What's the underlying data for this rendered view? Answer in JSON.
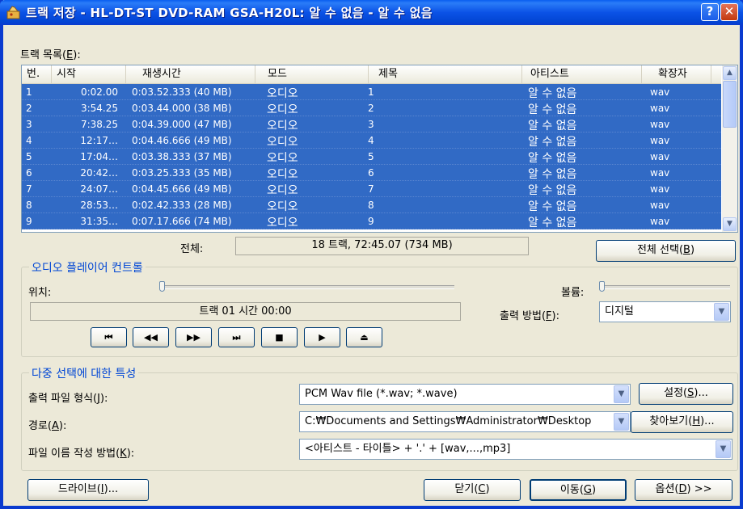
{
  "window": {
    "title": "트랙 저장 - HL-DT-ST DVD-RAM GSA-H20L:  알 수 없음  - 알 수 없음",
    "help_label": "?",
    "close_label": "✕"
  },
  "tracklist": {
    "label_prefix": "트랙 목록(",
    "label_key": "E",
    "label_suffix": "):",
    "headers": [
      "번.",
      "시작",
      "재생시간",
      "모드",
      "제목",
      "아티스트",
      "확장자"
    ],
    "rows": [
      {
        "num": "1",
        "start": "0:02.00",
        "duration": "0:03.52.333 (40 MB)",
        "mode": "오디오",
        "title": "1",
        "artist": "알 수 없음",
        "ext": "wav"
      },
      {
        "num": "2",
        "start": "3:54.25",
        "duration": "0:03.44.000 (38 MB)",
        "mode": "오디오",
        "title": "2",
        "artist": "알 수 없음",
        "ext": "wav"
      },
      {
        "num": "3",
        "start": "7:38.25",
        "duration": "0:04.39.000 (47 MB)",
        "mode": "오디오",
        "title": "3",
        "artist": "알 수 없음",
        "ext": "wav"
      },
      {
        "num": "4",
        "start": "12:17…",
        "duration": "0:04.46.666 (49 MB)",
        "mode": "오디오",
        "title": "4",
        "artist": "알 수 없음",
        "ext": "wav"
      },
      {
        "num": "5",
        "start": "17:04…",
        "duration": "0:03.38.333 (37 MB)",
        "mode": "오디오",
        "title": "5",
        "artist": "알 수 없음",
        "ext": "wav"
      },
      {
        "num": "6",
        "start": "20:42…",
        "duration": "0:03.25.333 (35 MB)",
        "mode": "오디오",
        "title": "6",
        "artist": "알 수 없음",
        "ext": "wav"
      },
      {
        "num": "7",
        "start": "24:07…",
        "duration": "0:04.45.666 (49 MB)",
        "mode": "오디오",
        "title": "7",
        "artist": "알 수 없음",
        "ext": "wav"
      },
      {
        "num": "8",
        "start": "28:53…",
        "duration": "0:02.42.333 (28 MB)",
        "mode": "오디오",
        "title": "8",
        "artist": "알 수 없음",
        "ext": "wav"
      },
      {
        "num": "9",
        "start": "31:35…",
        "duration": "0:07.17.666 (74 MB)",
        "mode": "오디오",
        "title": "9",
        "artist": "알 수 없음",
        "ext": "wav"
      }
    ],
    "scroll_up_icon": "▲",
    "scroll_down_icon": "▼"
  },
  "summary": {
    "label": "전체:",
    "value": "18 트랙,  72:45.07 (734 MB)",
    "select_all_prefix": "전체 선택(",
    "select_all_key": "B",
    "select_all_suffix": ")"
  },
  "player": {
    "group_title": "오디오 플레이어 컨트롤",
    "position_label": "위치:",
    "volume_label": "볼륨:",
    "status": "트랙 01 시간 00:00",
    "output_method_prefix": "출력 방법(",
    "output_method_key": "F",
    "output_method_suffix": "):",
    "output_method_value": "디지털",
    "position_value": 0,
    "volume_value": 0,
    "buttons": [
      {
        "name": "skip-to-start-icon",
        "glyph": "⏮"
      },
      {
        "name": "rewind-icon",
        "glyph": "◀◀"
      },
      {
        "name": "fast-forward-icon",
        "glyph": "▶▶"
      },
      {
        "name": "skip-to-end-icon",
        "glyph": "⏭"
      },
      {
        "name": "stop-icon",
        "glyph": "■"
      },
      {
        "name": "play-icon",
        "glyph": "▶"
      },
      {
        "name": "eject-icon",
        "glyph": "⏏"
      }
    ]
  },
  "multi": {
    "group_title": "다중 선택에 대한 특성",
    "format_prefix": "출력 파일 형식(",
    "format_key": "J",
    "format_suffix": "):",
    "format_value": "PCM Wav file (*.wav; *.wave)",
    "settings_prefix": "설정(",
    "settings_key": "S",
    "settings_suffix": ")...",
    "path_prefix": "경로(",
    "path_key": "A",
    "path_suffix": "):",
    "path_value": "C:₩Documents and Settings₩Administrator₩Desktop",
    "browse_prefix": "찾아보기(",
    "browse_key": "H",
    "browse_suffix": ")...",
    "naming_prefix": "파일 이름 작성 방법(",
    "naming_key": "K",
    "naming_suffix": "):",
    "naming_value": "<아티스트 - 타이틀> + '.' + [wav,...,mp3]"
  },
  "footer": {
    "drive_prefix": "드라이브(",
    "drive_key": "I",
    "drive_suffix": ")...",
    "close_prefix": "닫기(",
    "close_key": "C",
    "close_suffix": ")",
    "move_prefix": "이동(",
    "move_key": "G",
    "move_suffix": ")",
    "options_prefix": "옵션(",
    "options_key": "D",
    "options_suffix": ") >>"
  },
  "colors": {
    "titlebar": "#0A5EF0",
    "selection": "#316AC5",
    "group_title": "#0046D5",
    "dialog_bg": "#ECE9D8"
  }
}
